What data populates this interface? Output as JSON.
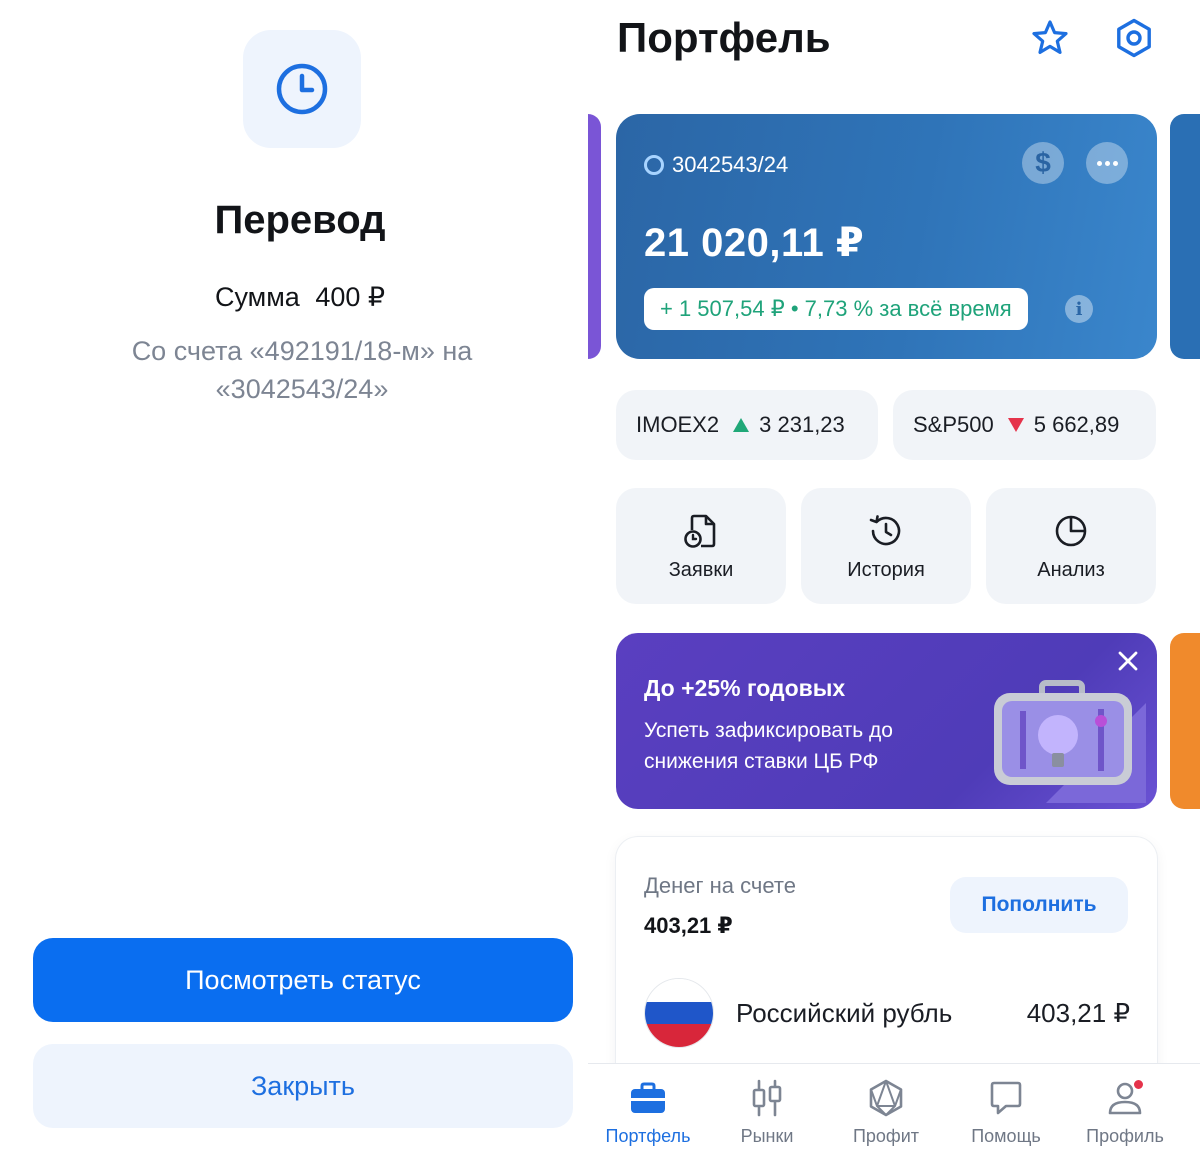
{
  "transfer": {
    "title": "Перевод",
    "amount_label": "Сумма",
    "amount_value": "400 ₽",
    "from_text": "Со счета «492191/18-м» на «3042543/24»",
    "status_button": "Посмотреть статус",
    "close_button": "Закрыть"
  },
  "portfolio": {
    "title": "Портфель",
    "account": {
      "id": "3042543/24",
      "total": "21 020,11 ₽",
      "gain": "+ 1 507,54 ₽ • 7,73 % за всё время",
      "currency_symbol": "$"
    },
    "indices": [
      {
        "name": "IMOEX2",
        "value": "3 231,23",
        "trend": "up"
      },
      {
        "name": "S&P500",
        "value": "5 662,89",
        "trend": "down"
      }
    ],
    "actions": [
      {
        "label": "Заявки",
        "icon": "orders-icon"
      },
      {
        "label": "История",
        "icon": "history-icon"
      },
      {
        "label": "Анализ",
        "icon": "pie-chart-icon"
      }
    ],
    "promo": {
      "title": "До +25% годовых",
      "text": "Успеть зафиксировать до снижения ставки ЦБ РФ"
    },
    "money": {
      "label": "Денег на счете",
      "value": "403,21 ₽",
      "topup_button": "Пополнить",
      "currency_name": "Российский рубль",
      "currency_value": "403,21 ₽"
    },
    "tabs": [
      {
        "label": "Портфель",
        "active": true
      },
      {
        "label": "Рынки",
        "active": false
      },
      {
        "label": "Профит",
        "active": false
      },
      {
        "label": "Помощь",
        "active": false
      },
      {
        "label": "Профиль",
        "active": false
      }
    ]
  },
  "colors": {
    "primary_blue": "#0a6ef0",
    "accent_text_blue": "#1d6fe0",
    "card_blue": "#2f74b8",
    "gain_green": "#1fa37a",
    "up_green": "#20a878",
    "down_red": "#e5334b",
    "promo_purple": "#5a3fc0"
  }
}
